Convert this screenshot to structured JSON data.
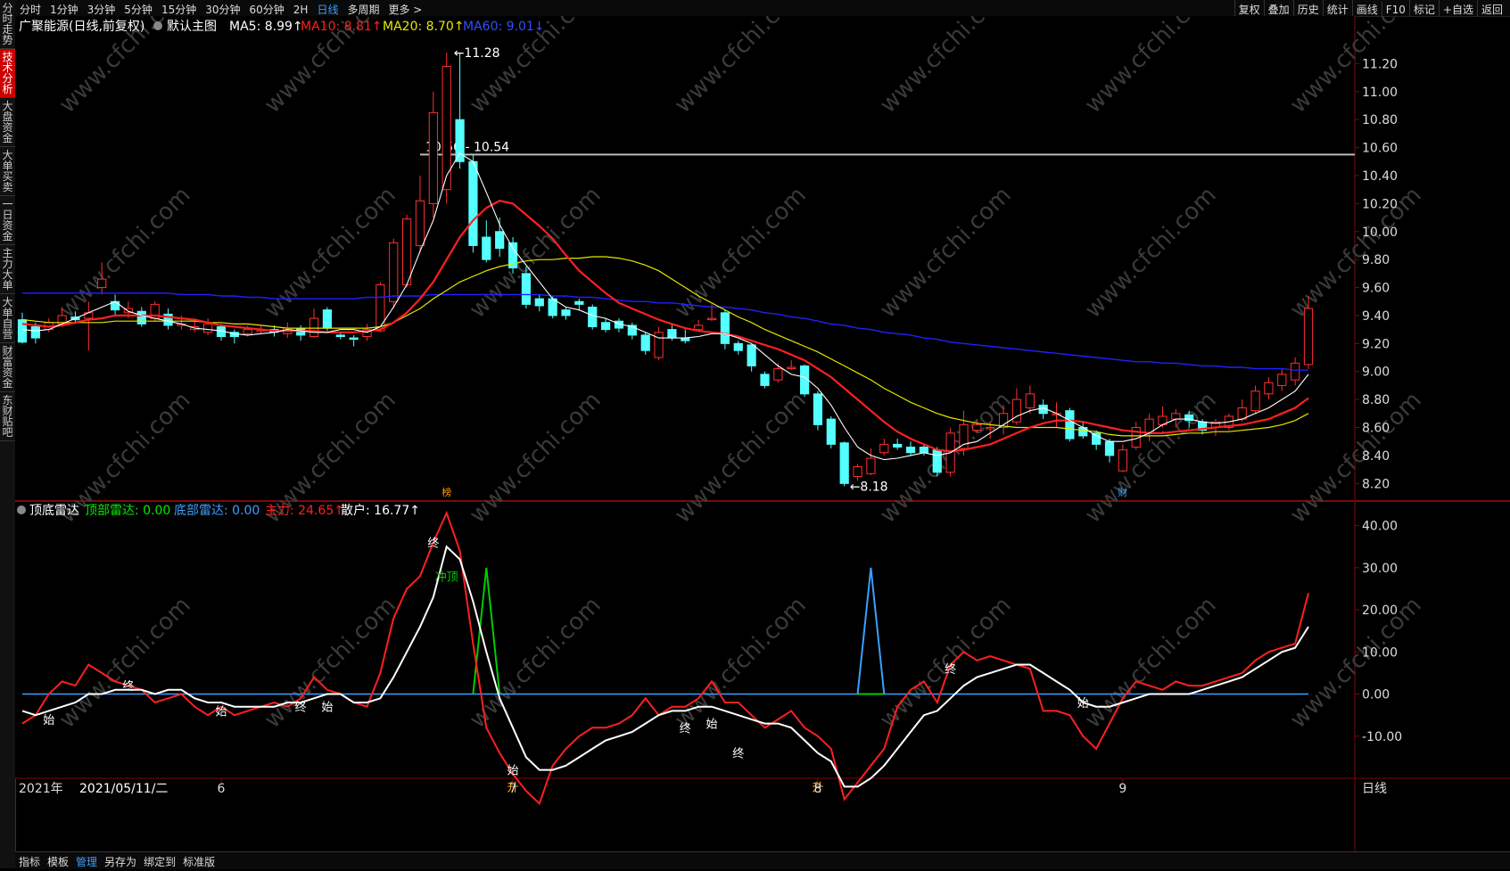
{
  "left_tabs": [
    "分时走势",
    "技术分析",
    "大盘资金",
    "大单买卖",
    "一日资金",
    "主力大单",
    "大单自营",
    "财富资金",
    "东财贴吧"
  ],
  "active_left_tab": 1,
  "periods": [
    "分时",
    "1分钟",
    "3分钟",
    "5分钟",
    "15分钟",
    "30分钟",
    "60分钟",
    "2H",
    "日线",
    "多周期",
    "更多 >"
  ],
  "active_period": 8,
  "tools": [
    "复权",
    "叠加",
    "历史",
    "统计",
    "画线",
    "F10",
    "标记",
    "+自选",
    "返回"
  ],
  "main": {
    "title": "广聚能源(日线,前复权)",
    "template": "默认主图",
    "ma5": "MA5: 8.99↑",
    "ma10": "MA10: 8.81↑",
    "ma20": "MA20: 8.70↑",
    "ma60": "MA60: 9.01↓",
    "high_label": "11.28",
    "low_label": "8.18",
    "range_label": "10.56 - 10.54",
    "marker_1": "榜",
    "marker_2": "财",
    "price_ticks": [
      "11.20",
      "11.00",
      "10.80",
      "10.60",
      "10.40",
      "10.20",
      "10.00",
      "9.80",
      "9.60",
      "9.40",
      "9.20",
      "9.00",
      "8.80",
      "8.60",
      "8.40",
      "8.20"
    ]
  },
  "sub": {
    "title": "顶底雷达",
    "top_radar": "顶部雷达: 0.00",
    "bottom_radar": "底部雷达: 0.00",
    "main_force": "主力: 24.65↑",
    "retail": "散户: 16.77↑",
    "ticks": [
      "40.00",
      "30.00",
      "20.00",
      "10.00",
      "0.00",
      "-10.00"
    ],
    "labels": [
      "始",
      "终",
      "始",
      "终",
      "始",
      "终",
      "冲顶",
      "始",
      "升",
      "终",
      "始",
      "终",
      "升",
      "终",
      "始"
    ]
  },
  "x_axis": {
    "year": "2021年",
    "date": "2021/05/11/二",
    "months": [
      "6",
      "7",
      "8",
      "9"
    ],
    "period_label": "日线"
  },
  "bottom_bar": [
    "指标",
    "模板",
    "管理",
    "另存为",
    "绑定到",
    "标准版"
  ],
  "active_bottom": 2,
  "colors": {
    "up": "#ff3030",
    "down": "#54ffff",
    "ma5": "#ffffff",
    "ma10": "#ff2020",
    "ma20": "#e6e600",
    "ma60": "#2020ff",
    "top": "#00cc00",
    "bottom": "#3aa0ff",
    "zero": "#3aa0ff",
    "bg": "#000000",
    "grid": "#7a0a0a"
  },
  "watermark": "www.cfchi.com",
  "chart_data": {
    "type": "candlestick",
    "price_range": [
      8.1,
      11.4
    ],
    "candles": [
      [
        9.37,
        9.21,
        9.42,
        9.2
      ],
      [
        9.32,
        9.24,
        9.35,
        9.2
      ],
      [
        9.3,
        9.35,
        9.38,
        9.28
      ],
      [
        9.34,
        9.4,
        9.46,
        9.32
      ],
      [
        9.39,
        9.37,
        9.43,
        9.34
      ],
      [
        9.38,
        9.42,
        9.5,
        9.15
      ],
      [
        9.6,
        9.66,
        9.78,
        9.55
      ],
      [
        9.5,
        9.44,
        9.55,
        9.4
      ],
      [
        9.42,
        9.45,
        9.5,
        9.38
      ],
      [
        9.43,
        9.34,
        9.46,
        9.32
      ],
      [
        9.38,
        9.48,
        9.5,
        9.36
      ],
      [
        9.41,
        9.33,
        9.45,
        9.3
      ],
      [
        9.33,
        9.34,
        9.4,
        9.3
      ],
      [
        9.3,
        9.32,
        9.36,
        9.28
      ],
      [
        9.28,
        9.34,
        9.38,
        9.26
      ],
      [
        9.32,
        9.25,
        9.34,
        9.22
      ],
      [
        9.28,
        9.25,
        9.3,
        9.2
      ],
      [
        9.27,
        9.3,
        9.33,
        9.25
      ],
      [
        9.29,
        9.3,
        9.33,
        9.27
      ],
      [
        9.3,
        9.28,
        9.33,
        9.25
      ],
      [
        9.27,
        9.31,
        9.35,
        9.24
      ],
      [
        9.31,
        9.26,
        9.33,
        9.22
      ],
      [
        9.25,
        9.38,
        9.45,
        9.24
      ],
      [
        9.44,
        9.31,
        9.46,
        9.29
      ],
      [
        9.26,
        9.25,
        9.28,
        9.23
      ],
      [
        9.24,
        9.23,
        9.26,
        9.18
      ],
      [
        9.25,
        9.3,
        9.34,
        9.22
      ],
      [
        9.29,
        9.62,
        9.64,
        9.28
      ],
      [
        9.5,
        9.92,
        9.95,
        9.45
      ],
      [
        9.62,
        10.09,
        10.12,
        9.6
      ],
      [
        9.9,
        10.22,
        10.4,
        9.85
      ],
      [
        10.2,
        10.85,
        11.0,
        10.1
      ],
      [
        10.3,
        11.18,
        11.28,
        10.2
      ],
      [
        10.8,
        10.5,
        11.28,
        10.45
      ],
      [
        10.5,
        9.9,
        10.55,
        9.85
      ],
      [
        9.96,
        9.8,
        10.08,
        9.78
      ],
      [
        10.0,
        9.88,
        10.1,
        9.82
      ],
      [
        9.92,
        9.74,
        9.96,
        9.7
      ],
      [
        9.7,
        9.48,
        9.75,
        9.45
      ],
      [
        9.52,
        9.47,
        9.55,
        9.43
      ],
      [
        9.52,
        9.4,
        9.54,
        9.38
      ],
      [
        9.44,
        9.4,
        9.46,
        9.37
      ],
      [
        9.5,
        9.48,
        9.52,
        9.44
      ],
      [
        9.46,
        9.32,
        9.48,
        9.3
      ],
      [
        9.35,
        9.3,
        9.38,
        9.28
      ],
      [
        9.36,
        9.31,
        9.38,
        9.28
      ],
      [
        9.33,
        9.26,
        9.35,
        9.23
      ],
      [
        9.26,
        9.15,
        9.28,
        9.12
      ],
      [
        9.1,
        9.28,
        9.32,
        9.08
      ],
      [
        9.3,
        9.24,
        9.34,
        9.22
      ],
      [
        9.24,
        9.22,
        9.3,
        9.2
      ],
      [
        9.3,
        9.33,
        9.37,
        9.3
      ],
      [
        9.38,
        9.38,
        9.48,
        9.36
      ],
      [
        9.42,
        9.2,
        9.44,
        9.16
      ],
      [
        9.2,
        9.15,
        9.22,
        9.12
      ],
      [
        9.19,
        9.04,
        9.2,
        9.0
      ],
      [
        8.98,
        8.9,
        9.0,
        8.88
      ],
      [
        8.94,
        9.02,
        9.06,
        8.92
      ],
      [
        9.02,
        9.03,
        9.08,
        9.01
      ],
      [
        9.04,
        8.84,
        9.05,
        8.82
      ],
      [
        8.84,
        8.62,
        8.86,
        8.58
      ],
      [
        8.66,
        8.48,
        8.68,
        8.45
      ],
      [
        8.49,
        8.2,
        8.5,
        8.18
      ],
      [
        8.25,
        8.32,
        8.34,
        8.22
      ],
      [
        8.27,
        8.38,
        8.45,
        8.26
      ],
      [
        8.42,
        8.48,
        8.52,
        8.4
      ],
      [
        8.48,
        8.46,
        8.52,
        8.44
      ],
      [
        8.46,
        8.42,
        8.5,
        8.4
      ],
      [
        8.46,
        8.42,
        8.48,
        8.4
      ],
      [
        8.44,
        8.28,
        8.46,
        8.25
      ],
      [
        8.28,
        8.56,
        8.6,
        8.25
      ],
      [
        8.45,
        8.62,
        8.72,
        8.4
      ],
      [
        8.58,
        8.62,
        8.66,
        8.56
      ],
      [
        8.6,
        8.6,
        8.64,
        8.52
      ],
      [
        8.6,
        8.7,
        8.76,
        8.55
      ],
      [
        8.64,
        8.8,
        8.88,
        8.62
      ],
      [
        8.74,
        8.84,
        8.9,
        8.7
      ],
      [
        8.76,
        8.7,
        8.8,
        8.66
      ],
      [
        8.69,
        8.7,
        8.78,
        8.6
      ],
      [
        8.72,
        8.52,
        8.74,
        8.5
      ],
      [
        8.6,
        8.54,
        8.64,
        8.52
      ],
      [
        8.56,
        8.48,
        8.58,
        8.44
      ],
      [
        8.5,
        8.4,
        8.52,
        8.35
      ],
      [
        8.29,
        8.44,
        8.48,
        8.28
      ],
      [
        8.46,
        8.6,
        8.64,
        8.44
      ],
      [
        8.56,
        8.66,
        8.7,
        8.5
      ],
      [
        8.62,
        8.68,
        8.75,
        8.6
      ],
      [
        8.66,
        8.7,
        8.73,
        8.6
      ],
      [
        8.69,
        8.65,
        8.72,
        8.6
      ],
      [
        8.64,
        8.58,
        8.66,
        8.55
      ],
      [
        8.6,
        8.64,
        8.66,
        8.54
      ],
      [
        8.6,
        8.68,
        8.7,
        8.58
      ],
      [
        8.66,
        8.74,
        8.8,
        8.64
      ],
      [
        8.72,
        8.86,
        8.9,
        8.7
      ],
      [
        8.84,
        8.92,
        8.96,
        8.8
      ],
      [
        8.9,
        8.98,
        9.02,
        8.86
      ],
      [
        8.94,
        9.06,
        9.1,
        8.9
      ],
      [
        9.05,
        9.45,
        9.54,
        9.02
      ]
    ],
    "ma_series": {
      "ma5": [
        9.3,
        9.29,
        9.3,
        9.34,
        9.38,
        9.42,
        9.46,
        9.5,
        9.43,
        9.4,
        9.38,
        9.36,
        9.34,
        9.31,
        9.3,
        9.29,
        9.27,
        9.26,
        9.27,
        9.28,
        9.3,
        9.29,
        9.28,
        9.28,
        9.3,
        9.3,
        9.28,
        9.32,
        9.46,
        9.62,
        9.86,
        10.08,
        10.4,
        10.56,
        10.5,
        10.28,
        10.05,
        9.88,
        9.76,
        9.64,
        9.52,
        9.46,
        9.44,
        9.4,
        9.38,
        9.34,
        9.32,
        9.28,
        9.24,
        9.24,
        9.24,
        9.25,
        9.27,
        9.27,
        9.24,
        9.2,
        9.12,
        9.04,
        8.98,
        8.96,
        8.88,
        8.76,
        8.6,
        8.46,
        8.4,
        8.37,
        8.38,
        8.4,
        8.42,
        8.4,
        8.42,
        8.48,
        8.5,
        8.56,
        8.62,
        8.68,
        8.72,
        8.74,
        8.7,
        8.65,
        8.6,
        8.54,
        8.5,
        8.5,
        8.52,
        8.56,
        8.62,
        8.66,
        8.66,
        8.64,
        8.63,
        8.64,
        8.66,
        8.7,
        8.74,
        8.8,
        8.86,
        8.98
      ],
      "ma10": [
        9.34,
        9.33,
        9.32,
        9.33,
        9.35,
        9.37,
        9.38,
        9.4,
        9.4,
        9.4,
        9.4,
        9.39,
        9.38,
        9.37,
        9.35,
        9.33,
        9.32,
        9.31,
        9.3,
        9.29,
        9.29,
        9.29,
        9.29,
        9.28,
        9.28,
        9.28,
        9.29,
        9.3,
        9.35,
        9.42,
        9.52,
        9.64,
        9.8,
        9.96,
        10.08,
        10.17,
        10.22,
        10.2,
        10.12,
        10.04,
        9.95,
        9.83,
        9.72,
        9.64,
        9.56,
        9.49,
        9.45,
        9.41,
        9.37,
        9.34,
        9.31,
        9.29,
        9.28,
        9.27,
        9.25,
        9.22,
        9.19,
        9.16,
        9.12,
        9.08,
        9.02,
        8.96,
        8.88,
        8.8,
        8.72,
        8.64,
        8.57,
        8.52,
        8.48,
        8.44,
        8.43,
        8.44,
        8.46,
        8.48,
        8.52,
        8.56,
        8.6,
        8.63,
        8.65,
        8.65,
        8.64,
        8.62,
        8.6,
        8.58,
        8.57,
        8.56,
        8.56,
        8.57,
        8.58,
        8.59,
        8.6,
        8.61,
        8.62,
        8.64,
        8.66,
        8.7,
        8.74,
        8.81
      ],
      "ma20": [
        9.37,
        9.36,
        9.35,
        9.35,
        9.35,
        9.35,
        9.35,
        9.36,
        9.36,
        9.36,
        9.36,
        9.36,
        9.36,
        9.36,
        9.35,
        9.35,
        9.34,
        9.34,
        9.33,
        9.32,
        9.31,
        9.31,
        9.31,
        9.31,
        9.31,
        9.31,
        9.31,
        9.32,
        9.35,
        9.4,
        9.45,
        9.52,
        9.58,
        9.64,
        9.68,
        9.72,
        9.75,
        9.77,
        9.79,
        9.8,
        9.8,
        9.81,
        9.81,
        9.82,
        9.82,
        9.81,
        9.79,
        9.76,
        9.72,
        9.66,
        9.6,
        9.54,
        9.49,
        9.44,
        9.39,
        9.35,
        9.3,
        9.26,
        9.22,
        9.18,
        9.14,
        9.09,
        9.04,
        8.99,
        8.94,
        8.88,
        8.83,
        8.78,
        8.74,
        8.7,
        8.67,
        8.65,
        8.63,
        8.62,
        8.61,
        8.6,
        8.6,
        8.6,
        8.6,
        8.59,
        8.58,
        8.57,
        8.55,
        8.54,
        8.54,
        8.54,
        8.54,
        8.55,
        8.56,
        8.56,
        8.57,
        8.57,
        8.58,
        8.59,
        8.6,
        8.62,
        8.65,
        8.7
      ],
      "ma60": [
        9.56,
        9.56,
        9.56,
        9.56,
        9.56,
        9.56,
        9.56,
        9.56,
        9.56,
        9.56,
        9.56,
        9.56,
        9.55,
        9.55,
        9.55,
        9.54,
        9.54,
        9.53,
        9.53,
        9.52,
        9.52,
        9.52,
        9.52,
        9.52,
        9.52,
        9.52,
        9.53,
        9.53,
        9.54,
        9.54,
        9.54,
        9.55,
        9.55,
        9.55,
        9.55,
        9.55,
        9.55,
        9.55,
        9.55,
        9.55,
        9.54,
        9.54,
        9.53,
        9.53,
        9.52,
        9.51,
        9.5,
        9.5,
        9.49,
        9.49,
        9.48,
        9.47,
        9.46,
        9.46,
        9.45,
        9.44,
        9.42,
        9.41,
        9.39,
        9.38,
        9.36,
        9.34,
        9.33,
        9.31,
        9.3,
        9.28,
        9.27,
        9.26,
        9.24,
        9.23,
        9.21,
        9.2,
        9.19,
        9.18,
        9.17,
        9.16,
        9.15,
        9.14,
        9.13,
        9.12,
        9.11,
        9.1,
        9.09,
        9.08,
        9.07,
        9.07,
        9.06,
        9.06,
        9.05,
        9.04,
        9.04,
        9.03,
        9.03,
        9.02,
        9.02,
        9.02,
        9.01,
        9.01
      ]
    },
    "indicator": {
      "y_range": [
        -20,
        45
      ],
      "main_force": [
        -7,
        -5,
        0,
        3,
        2,
        7,
        5,
        3,
        2,
        1,
        -2,
        -1,
        0,
        -3,
        -5,
        -3,
        -5,
        -4,
        -3,
        -2,
        -3,
        -1,
        4,
        1,
        0,
        -2,
        -3,
        5,
        18,
        25,
        28,
        36,
        43,
        34,
        12,
        -8,
        -14,
        -19,
        -23,
        -26,
        -17,
        -13,
        -10,
        -8,
        -8,
        -7,
        -5,
        -1,
        -5,
        -3,
        -3,
        -1,
        3,
        -2,
        -2,
        -5,
        -8,
        -6,
        -4,
        -8,
        -10,
        -13,
        -25,
        -21,
        -17,
        -13,
        -3,
        1,
        3,
        -2,
        7,
        10,
        8,
        9,
        8,
        7,
        6,
        -4,
        -4,
        -5,
        -10,
        -13,
        -7,
        -1,
        3,
        2,
        1,
        3,
        2,
        2,
        3,
        4,
        5,
        8,
        10,
        11,
        12,
        24
      ],
      "retail": [
        -4,
        -5,
        -4,
        -3,
        -2,
        0,
        0,
        1,
        1,
        1,
        0,
        1,
        1,
        -1,
        -2,
        -2,
        -3,
        -3,
        -3,
        -3,
        -2,
        -2,
        -1,
        0,
        0,
        -2,
        -2,
        -1,
        4,
        10,
        16,
        23,
        35,
        32,
        22,
        10,
        -1,
        -8,
        -15,
        -18,
        -18,
        -17,
        -15,
        -13,
        -11,
        -10,
        -9,
        -7,
        -5,
        -4,
        -4,
        -3,
        -3,
        -4,
        -5,
        -6,
        -7,
        -7,
        -8,
        -11,
        -14,
        -16,
        -22,
        -22,
        -20,
        -17,
        -13,
        -9,
        -5,
        -4,
        -1,
        2,
        4,
        5,
        6,
        7,
        7,
        5,
        3,
        1,
        -2,
        -3,
        -3,
        -2,
        -1,
        0,
        0,
        0,
        0,
        1,
        2,
        3,
        4,
        6,
        8,
        10,
        11,
        16
      ],
      "top_radar_spike": {
        "index": 35,
        "value": 30
      },
      "bottom_radar_spike": {
        "index": 64,
        "value": 30
      }
    }
  }
}
